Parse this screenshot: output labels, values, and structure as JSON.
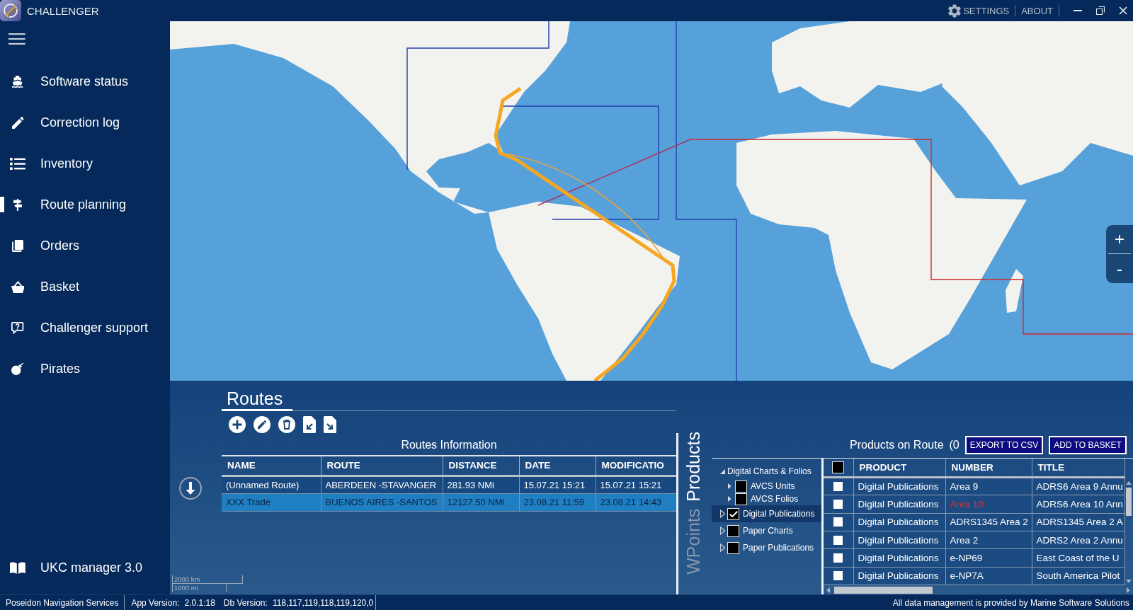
{
  "window": {
    "title": "CHALLENGER",
    "menu": [
      {
        "kind": "settings",
        "label": "SETTINGS"
      },
      {
        "kind": "about",
        "label": "ABOUT"
      }
    ]
  },
  "sidebar": {
    "items": [
      {
        "label": "Software status",
        "selected": false
      },
      {
        "label": "Correction log",
        "selected": false
      },
      {
        "label": "Inventory",
        "selected": false
      },
      {
        "label": "Route planning",
        "selected": true
      },
      {
        "label": "Orders",
        "selected": false
      },
      {
        "label": "Basket",
        "selected": false
      },
      {
        "label": "Challenger support",
        "selected": false
      },
      {
        "label": "Pirates",
        "selected": false
      }
    ],
    "footer": {
      "label": "UKC manager 3.0",
      "selected": false
    }
  },
  "map": {
    "zoom_buttons": [
      "+",
      "-"
    ],
    "scale_bar": [
      "2000 km",
      "1000 mi"
    ]
  },
  "routes": {
    "title": "Routes",
    "caption": "Routes Information",
    "columns": [
      "NAME",
      "ROUTE",
      "DISTANCE",
      "DATE",
      "MODIFICATIO"
    ],
    "rows": [
      {
        "selected": false,
        "cells": [
          "(Unnamed Route)",
          "ABERDEEN -STAVANGER",
          "281.93 NMi",
          "15.07.21 15:21",
          "15.07.21 15:21"
        ]
      },
      {
        "selected": true,
        "cells": [
          "XXX Trade",
          "BUENOS AIRES -SANTOS",
          "12127.50 NMi",
          "23.08.21 11:59",
          "23.08.21 14:43"
        ]
      }
    ]
  },
  "products": {
    "tabs": [
      {
        "label": "WPoints",
        "selected": false
      },
      {
        "label": "Products",
        "selected": true
      }
    ],
    "heading": "Products on Route",
    "count": "(0",
    "buttons": [
      "EXPORT TO CSV",
      "ADD TO BASKET"
    ],
    "tree": [
      {
        "kind": "category",
        "label": "Digital Charts & Folios",
        "expanded": true,
        "selected": false,
        "children": [
          {
            "kind": "option",
            "label": "AVCS Units",
            "expanded": false,
            "checked": false,
            "selected": false
          },
          {
            "kind": "option",
            "label": "AVCS Folios",
            "expanded": false,
            "checked": false,
            "selected": false
          }
        ]
      },
      {
        "kind": "option",
        "label": "Digital Publications",
        "expanded": false,
        "checked": true,
        "selected": true
      },
      {
        "kind": "option",
        "label": "Paper Charts",
        "expanded": false,
        "checked": false,
        "selected": false
      },
      {
        "kind": "option",
        "label": "Paper Publications",
        "expanded": false,
        "checked": false,
        "selected": false
      }
    ],
    "table": {
      "all_checked": false,
      "columns": [
        "PRODUCT",
        "NUMBER",
        "TITLE"
      ],
      "rows": [
        {
          "checked": false,
          "flagged": false,
          "cells": [
            "Digital Publications",
            "Area 9",
            "ADRS6 Area 9 Annu"
          ]
        },
        {
          "checked": false,
          "flagged": true,
          "cells": [
            "Digital Publications",
            "Area 10",
            "ADRS6 Area 10 Ann"
          ]
        },
        {
          "checked": false,
          "flagged": false,
          "cells": [
            "Digital Publications",
            "ADRS1345 Area 2",
            "ADRS1345 Area 2 A"
          ]
        },
        {
          "checked": false,
          "flagged": false,
          "cells": [
            "Digital Publications",
            "Area 2",
            "ADRS2 Area 2 Annu"
          ]
        },
        {
          "checked": false,
          "flagged": false,
          "cells": [
            "Digital Publications",
            "e-NP69",
            "East Coast of the U"
          ]
        },
        {
          "checked": false,
          "flagged": false,
          "cells": [
            "Digital Publications",
            "e-NP7A",
            "South America Pilot"
          ]
        }
      ]
    }
  },
  "status_bar": {
    "company": "Poseidon Navigation Services",
    "fields": [
      {
        "label": "App Version:",
        "value": "2.0.1:18"
      },
      {
        "label": "Db Version:",
        "value": "118,117,119,118,119,120,0"
      }
    ],
    "notice": "All data management is provided by Marine Software Solutions"
  }
}
